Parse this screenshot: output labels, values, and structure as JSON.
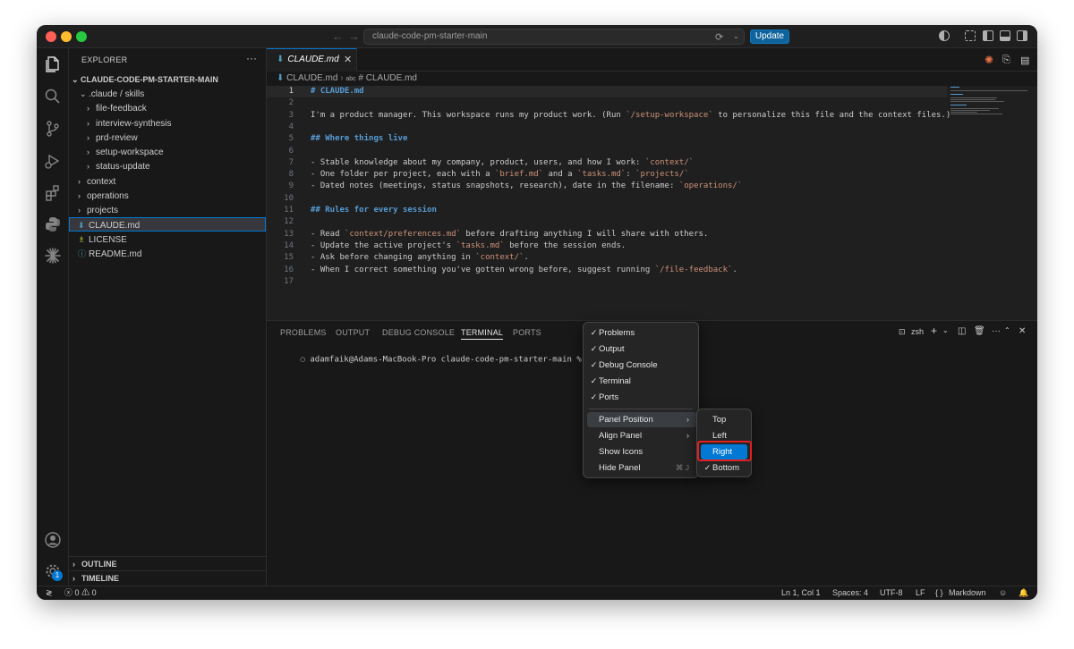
{
  "titlebar": {
    "command_center": "claude-code-pm-starter-main",
    "update_label": "Update"
  },
  "explorer": {
    "title": "EXPLORER",
    "more": "···",
    "root": "CLAUDE-CODE-PM-STARTER-MAIN",
    "items": [
      {
        "label": ".claude / skills",
        "kind": "folder-open"
      },
      {
        "label": "file-feedback",
        "kind": "folder"
      },
      {
        "label": "interview-synthesis",
        "kind": "folder"
      },
      {
        "label": "prd-review",
        "kind": "folder"
      },
      {
        "label": "setup-workspace",
        "kind": "folder"
      },
      {
        "label": "status-update",
        "kind": "folder"
      },
      {
        "label": "context",
        "kind": "folder"
      },
      {
        "label": "operations",
        "kind": "folder"
      },
      {
        "label": "projects",
        "kind": "folder"
      },
      {
        "label": "CLAUDE.md",
        "kind": "file-md"
      },
      {
        "label": "LICENSE",
        "kind": "file-license"
      },
      {
        "label": "README.md",
        "kind": "file-info"
      }
    ],
    "outline": "OUTLINE",
    "timeline": "TIMELINE"
  },
  "editor": {
    "tab_label": "CLAUDE.md",
    "breadcrumb": [
      "CLAUDE.md",
      "# CLAUDE.md"
    ],
    "lines": [
      {
        "n": "1",
        "text": "# CLAUDE.md"
      },
      {
        "n": "2",
        "text": ""
      },
      {
        "n": "3",
        "text": "I'm a product manager. This workspace runs my product work. (Run `/setup-workspace` to personalize this file and the context files.)"
      },
      {
        "n": "4",
        "text": ""
      },
      {
        "n": "5",
        "text": "## Where things live"
      },
      {
        "n": "6",
        "text": ""
      },
      {
        "n": "7",
        "text": "- Stable knowledge about my company, product, users, and how I work: `context/`"
      },
      {
        "n": "8",
        "text": "- One folder per project, each with a `brief.md` and a `tasks.md`: `projects/`"
      },
      {
        "n": "9",
        "text": "- Dated notes (meetings, status snapshots, research), date in the filename: `operations/`"
      },
      {
        "n": "10",
        "text": ""
      },
      {
        "n": "11",
        "text": "## Rules for every session"
      },
      {
        "n": "12",
        "text": ""
      },
      {
        "n": "13",
        "text": "- Read `context/preferences.md` before drafting anything I will share with others."
      },
      {
        "n": "14",
        "text": "- Update the active project's `tasks.md` before the session ends."
      },
      {
        "n": "15",
        "text": "- Ask before changing anything in `context/`."
      },
      {
        "n": "16",
        "text": "- When I correct something you've gotten wrong before, suggest running `/file-feedback`."
      },
      {
        "n": "17",
        "text": ""
      }
    ]
  },
  "panel": {
    "tabs": [
      "PROBLEMS",
      "OUTPUT",
      "DEBUG CONSOLE",
      "TERMINAL",
      "PORTS"
    ],
    "active_tab": "TERMINAL",
    "terminal_prompt": "adamfaik@Adams-MacBook-Pro claude-code-pm-starter-main % ",
    "shell_label": "zsh"
  },
  "context_menu": {
    "checked_items": [
      "Problems",
      "Output",
      "Debug Console",
      "Terminal",
      "Ports"
    ],
    "panel_position": "Panel Position",
    "align_panel": "Align Panel",
    "show_icons": "Show Icons",
    "hide_panel": "Hide Panel",
    "hide_panel_shortcut": "⌘ J"
  },
  "submenu": {
    "items": [
      "Top",
      "Left",
      "Right",
      "Bottom"
    ],
    "highlighted": "Right",
    "checked": "Bottom"
  },
  "statusbar": {
    "errors": "0",
    "warnings": "0",
    "position": "Ln 1, Col 1",
    "spaces": "Spaces: 4",
    "encoding": "UTF-8",
    "eol": "LF",
    "language": "Markdown"
  },
  "activity_badge": "1"
}
